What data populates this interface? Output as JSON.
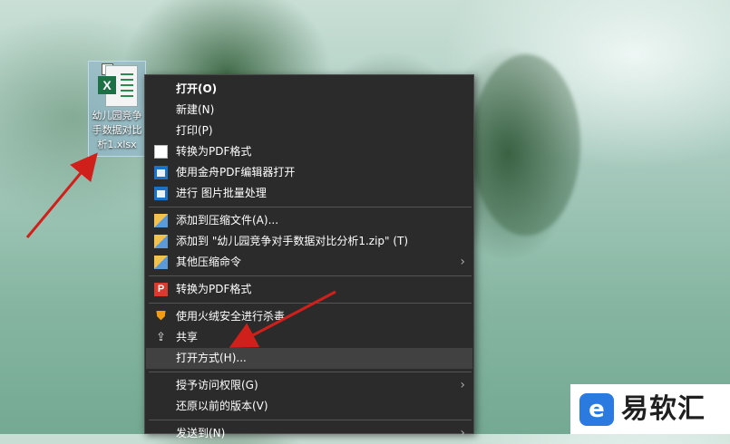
{
  "desktop": {
    "file_icon_label": "幼儿园竞争手数据对比析1.xlsx"
  },
  "context_menu": {
    "items": [
      {
        "label": "打开(O)",
        "bold": true
      },
      {
        "label": "新建(N)"
      },
      {
        "label": "打印(P)"
      },
      {
        "label": "转换为PDF格式",
        "icon": "pdf-doc-icon"
      },
      {
        "label": "使用金舟PDF编辑器打开",
        "icon": "window-icon"
      },
      {
        "label": "进行 图片批量处理",
        "icon": "window-icon"
      },
      {
        "label": "添加到压缩文件(A)...",
        "icon": "archive-icon"
      },
      {
        "label": "添加到 \"幼儿园竞争对手数据对比分析1.zip\" (T)",
        "icon": "archive-icon"
      },
      {
        "label": "其他压缩命令",
        "icon": "archive-icon",
        "submenu": true
      },
      {
        "label": "转换为PDF格式",
        "icon": "pdf-red-icon"
      },
      {
        "label": "使用火绒安全进行杀毒",
        "icon": "shield-icon"
      },
      {
        "label": "共享",
        "icon": "share-icon"
      },
      {
        "label": "打开方式(H)...",
        "highlighted": true
      },
      {
        "label": "授予访问权限(G)",
        "submenu": true
      },
      {
        "label": "还原以前的版本(V)"
      },
      {
        "label": "发送到(N)",
        "submenu": true
      }
    ],
    "submenu_arrow": "›"
  },
  "brand": {
    "name": "易软汇",
    "logo_glyph": "e"
  },
  "colors": {
    "menu_bg": "#2b2b2b",
    "menu_highlight": "#414141",
    "annotation_arrow": "#d0201b"
  }
}
